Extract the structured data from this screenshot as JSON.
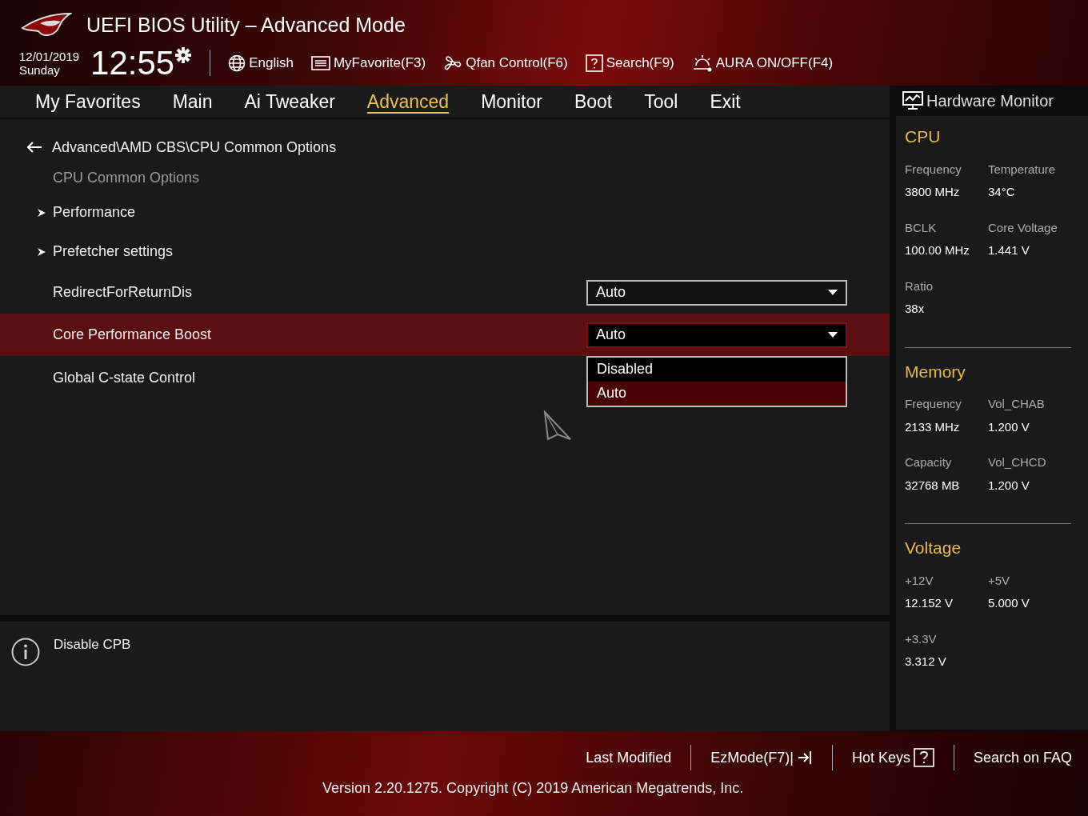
{
  "window": {
    "title": "UEFI BIOS Utility – Advanced Mode"
  },
  "clock": {
    "date": "12/01/2019",
    "day": "Sunday",
    "time": "12:55"
  },
  "toolbar": [
    {
      "kind": "language",
      "label": "English"
    },
    {
      "kind": "favorite",
      "label": "MyFavorite(F3)"
    },
    {
      "kind": "fan",
      "label": "Qfan Control(F6)"
    },
    {
      "kind": "search",
      "label": "Search(F9)"
    },
    {
      "kind": "aura",
      "label": "AURA ON/OFF(F4)"
    }
  ],
  "tabs": [
    {
      "label": "My Favorites",
      "selected": false
    },
    {
      "label": "Main",
      "selected": false
    },
    {
      "label": "Ai Tweaker",
      "selected": false
    },
    {
      "label": "Advanced",
      "selected": true
    },
    {
      "label": "Monitor",
      "selected": false
    },
    {
      "label": "Boot",
      "selected": false
    },
    {
      "label": "Tool",
      "selected": false
    },
    {
      "label": "Exit",
      "selected": false
    }
  ],
  "breadcrumb": "Advanced\\AMD CBS\\CPU Common Options",
  "items": [
    {
      "kind": "heading",
      "label": "CPU Common Options",
      "selected": false
    },
    {
      "kind": "submenu",
      "label": "Performance",
      "selected": false
    },
    {
      "kind": "submenu",
      "label": "Prefetcher settings",
      "selected": false
    },
    {
      "kind": "setting",
      "label": "RedirectForReturnDis",
      "value": "Auto",
      "selected": false,
      "expanded": false
    },
    {
      "kind": "setting",
      "label": "Core Performance Boost",
      "value": "Auto",
      "selected": true,
      "expanded": true,
      "options": [
        {
          "label": "Disabled",
          "selected": false
        },
        {
          "label": "Auto",
          "selected": true
        }
      ]
    },
    {
      "kind": "heading2",
      "label": "Global C-state Control",
      "selected": false
    }
  ],
  "help": "Disable CPB",
  "hardware_monitor": {
    "title": "Hardware Monitor",
    "sections": [
      {
        "title": "CPU",
        "readings": [
          {
            "label": "Frequency",
            "value": "3800 MHz"
          },
          {
            "label": "Temperature",
            "value": "34°C"
          },
          {
            "label": "BCLK",
            "value": "100.00 MHz"
          },
          {
            "label": "Core Voltage",
            "value": "1.441 V"
          },
          {
            "label": "Ratio",
            "value": "38x"
          }
        ]
      },
      {
        "title": "Memory",
        "readings": [
          {
            "label": "Frequency",
            "value": "2133 MHz"
          },
          {
            "label": "Vol_CHAB",
            "value": "1.200 V"
          },
          {
            "label": "Capacity",
            "value": "32768 MB"
          },
          {
            "label": "Vol_CHCD",
            "value": "1.200 V"
          }
        ]
      },
      {
        "title": "Voltage",
        "readings": [
          {
            "label": "+12V",
            "value": "12.152 V"
          },
          {
            "label": "+5V",
            "value": "5.000 V"
          },
          {
            "label": "+3.3V",
            "value": "3.312 V"
          }
        ]
      }
    ]
  },
  "footer": {
    "buttons": [
      {
        "kind": "plain",
        "label": "Last Modified"
      },
      {
        "kind": "exit",
        "label": "EzMode(F7)|"
      },
      {
        "kind": "help",
        "label": "Hot Keys"
      },
      {
        "kind": "plain",
        "label": "Search on FAQ"
      }
    ],
    "version": "Version 2.20.1275. Copyright (C) 2019 American Megatrends, Inc."
  }
}
